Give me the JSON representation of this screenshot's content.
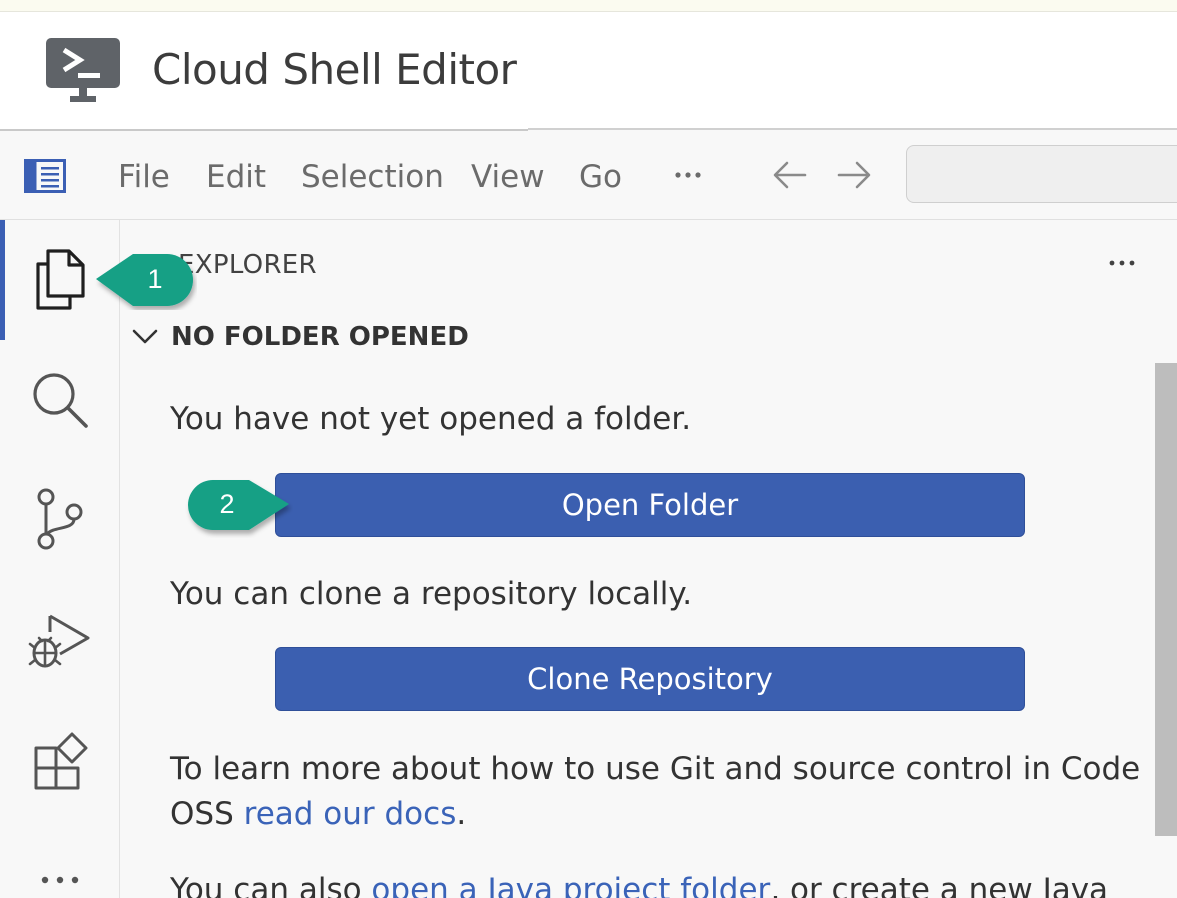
{
  "header": {
    "title": "Cloud Shell Editor",
    "logo_icon": "terminal-monitor-icon",
    "logo_color": "#5f6368"
  },
  "menubar": {
    "toggle_icon": "sidebar-toggle-icon",
    "items": [
      "File",
      "Edit",
      "Selection",
      "View",
      "Go"
    ],
    "more_icon": "ellipsis-icon",
    "back_icon": "arrow-left-icon",
    "forward_icon": "arrow-right-icon",
    "search_value": ""
  },
  "activity_bar": {
    "items": [
      {
        "icon": "explorer-files-icon",
        "active": true
      },
      {
        "icon": "search-icon",
        "active": false
      },
      {
        "icon": "source-control-icon",
        "active": false
      },
      {
        "icon": "run-debug-icon",
        "active": false
      },
      {
        "icon": "extensions-icon",
        "active": false
      },
      {
        "icon": "ellipsis-icon",
        "active": false
      }
    ],
    "accent": "#3b5fb4"
  },
  "explorer": {
    "title": "EXPLORER",
    "more_icon": "ellipsis-icon",
    "section_title": "NO FOLDER OPENED",
    "no_folder_text": "You have not yet opened a folder.",
    "open_folder_label": "Open Folder",
    "clone_text": "You can clone a repository locally.",
    "clone_label": "Clone Repository",
    "learn_more_line1": "To learn more about how to use Git and source control in Code",
    "learn_more_line2_prefix": "OSS ",
    "learn_more_link": "read our docs",
    "learn_more_line2_suffix": ".",
    "java_prefix": "You can also ",
    "java_link": "open a Java project folder",
    "java_suffix": ", or create a new Java",
    "button_color": "#3b5fb0",
    "link_color": "#3a63b8"
  },
  "callouts": [
    {
      "label": "1",
      "color": "#13a085"
    },
    {
      "label": "2",
      "color": "#13a085"
    }
  ]
}
